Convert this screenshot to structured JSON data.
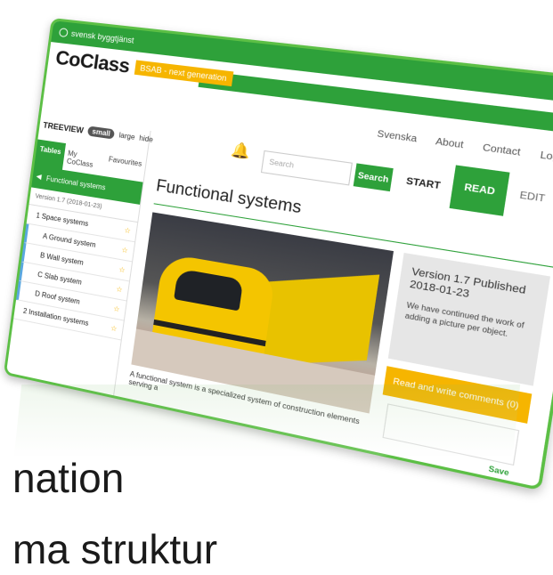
{
  "topbar": {
    "brand": "svensk byggtjänst"
  },
  "logo": {
    "name": "CoClass",
    "tagline": "BSAB - next generation"
  },
  "nav": {
    "items": [
      "Svenska",
      "About",
      "Contact",
      "Log out"
    ]
  },
  "search": {
    "placeholder": "Search",
    "button": "Search"
  },
  "modes": {
    "start": "START",
    "read": "READ",
    "edit": "EDIT"
  },
  "sidebar": {
    "treeview": "TREEVIEW",
    "size_small": "small",
    "size_large": "large",
    "hide": "hide",
    "tabs": [
      "Tables",
      "My CoClass",
      "Favourites"
    ],
    "header": "Functional systems",
    "version": "Version 1.7 (2018-01-23)",
    "tree": [
      {
        "label": "1  Space systems",
        "sub": false
      },
      {
        "label": "A  Ground system",
        "sub": true
      },
      {
        "label": "B  Wall system",
        "sub": true
      },
      {
        "label": "C  Slab system",
        "sub": true
      },
      {
        "label": "D  Roof system",
        "sub": true
      },
      {
        "label": "2  Installation systems",
        "sub": false
      }
    ]
  },
  "main": {
    "title": "Functional systems",
    "caption": "A functional system is a specialized system of construction elements serving a"
  },
  "info": {
    "heading": "Version 1.7 Published 2018-01-23",
    "body": "We have continued the work of adding a picture per object."
  },
  "comments": {
    "label": "Read and write comments (0)",
    "save": "Save"
  },
  "foreground": {
    "line1": "nation",
    "line2": "ma struktur"
  },
  "colors": {
    "brand_green": "#2ea13a",
    "accent_yellow": "#f6b500"
  }
}
